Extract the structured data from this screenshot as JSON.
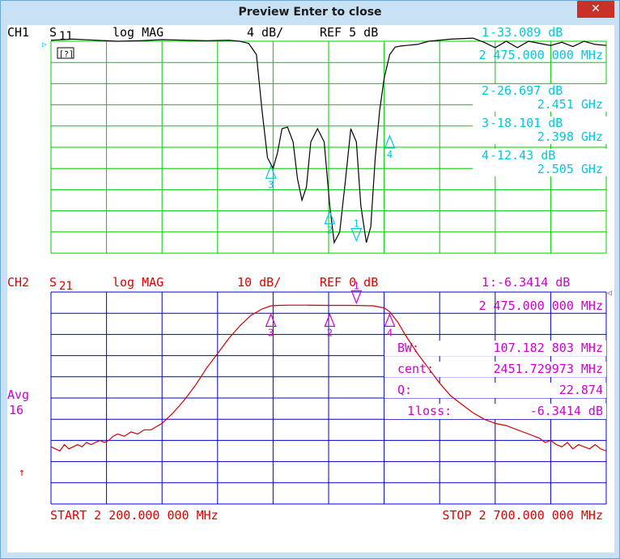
{
  "window": {
    "title": "Preview Enter to close",
    "close_glyph": "✕"
  },
  "colors": {
    "ch1_grid": "#00cc00",
    "ch1_trace": "#000000",
    "ch1_text": "#00c8e0",
    "ch2_grid": "#0000cc",
    "ch2_trace": "#d00000",
    "ch2_text": "#d000d0",
    "red_text": "#e00000"
  },
  "chart_data": [
    {
      "type": "line",
      "channel": "CH1",
      "header": {
        "ch": "CH1",
        "param": "S",
        "param_sub": "11",
        "format": "log MAG",
        "scale": "4 dB/",
        "ref": "REF 5 dB",
        "m1_num": "1",
        "m1_val": " -33.089 dB",
        "m1_freq": "2 475.000 000 MHz",
        "ref_marker": "▷"
      },
      "y_scale": {
        "per_div": 4,
        "ref_level": 5,
        "ref_division": 0,
        "divisions": 10
      },
      "x_range": [
        2200,
        2700
      ],
      "x_divisions": 10,
      "readouts": [
        {
          "num": "2",
          "value": " -26.697 dB",
          "freq": "2.451 GHz"
        },
        {
          "num": "3",
          "value": " -18.101 dB",
          "freq": "2.398 GHz"
        },
        {
          "num": "4",
          "value": " -12.43 dB",
          "freq": "2.505 GHz"
        }
      ],
      "markers": [
        {
          "label": "3",
          "x": 2398,
          "y": -18.1
        },
        {
          "label": "2",
          "x": 2451,
          "y": -26.7
        },
        {
          "label": "1",
          "x": 2475,
          "y": -33.1
        },
        {
          "label": "4",
          "x": 2505,
          "y": -12.4
        }
      ],
      "annotation_box": "⌈?⌉",
      "series": [
        {
          "x": [
            2200,
            2220,
            2240,
            2260,
            2280,
            2300,
            2320,
            2340,
            2360,
            2370,
            2378,
            2385,
            2390,
            2395,
            2400,
            2404,
            2408,
            2413,
            2418,
            2422,
            2426,
            2430,
            2434,
            2440,
            2446,
            2451,
            2455,
            2460,
            2465,
            2470,
            2475,
            2479,
            2484,
            2488,
            2492,
            2496,
            2500,
            2505,
            2510,
            2515,
            2520,
            2530,
            2540,
            2560,
            2580,
            2590,
            2600,
            2610,
            2620,
            2630,
            2640,
            2650,
            2660,
            2670,
            2680,
            2690,
            2700
          ],
          "y": [
            5.2,
            5.4,
            5.2,
            5.0,
            5.1,
            5.3,
            5.2,
            5.1,
            5.2,
            5.0,
            4.6,
            2.5,
            -8,
            -17,
            -19,
            -16,
            -11.5,
            -11.2,
            -14,
            -21,
            -25,
            -22.5,
            -14,
            -11.5,
            -14,
            -26,
            -33,
            -31,
            -21.5,
            -11.5,
            -14,
            -26,
            -33,
            -30,
            -17,
            -8,
            -2,
            2.5,
            3.9,
            4.1,
            4.2,
            4.4,
            5.0,
            5.4,
            5.6,
            4.8,
            3.8,
            5.0,
            3.8,
            5.0,
            4.6,
            4.2,
            4.8,
            4.0,
            5.0,
            4.4,
            4.2
          ]
        }
      ]
    },
    {
      "type": "line",
      "channel": "CH2",
      "header": {
        "ch": "CH2",
        "param": "S",
        "param_sub": "21",
        "format": "log MAG",
        "scale": "10 dB/",
        "ref": "REF 0 dB",
        "m1_num": "1",
        "m1_val": ":-6.3414 dB",
        "m1_freq": "2 475.000 000 MHz",
        "ref_marker": "◁"
      },
      "y_scale": {
        "per_div": 10,
        "ref_level": 0,
        "ref_division": 0,
        "divisions": 10
      },
      "x_range": [
        2200,
        2700
      ],
      "x_divisions": 10,
      "side_label": {
        "avg": "Avg",
        "count": "16",
        "arrow": "↑"
      },
      "readouts": [
        {
          "label": "BW:",
          "value": "107.182 803 MHz"
        },
        {
          "label": "cent:",
          "value": "2451.729973 MHz"
        },
        {
          "label": "Q:",
          "value": "22.874"
        },
        {
          "num": "1",
          "label": " loss:",
          "value": "-6.3414 dB"
        }
      ],
      "markers": [
        {
          "label": "3",
          "x": 2398,
          "y": -9.3
        },
        {
          "label": "2",
          "x": 2451,
          "y": -9.3
        },
        {
          "label": "1",
          "x": 2475,
          "y": -6.3
        },
        {
          "label": "4",
          "x": 2505,
          "y": -9.3
        }
      ],
      "series": [
        {
          "x": [
            2200,
            2204,
            2208,
            2212,
            2216,
            2220,
            2224,
            2228,
            2232,
            2236,
            2240,
            2244,
            2248,
            2252,
            2256,
            2260,
            2266,
            2272,
            2278,
            2284,
            2290,
            2300,
            2310,
            2320,
            2330,
            2340,
            2350,
            2360,
            2370,
            2380,
            2390,
            2398,
            2405,
            2415,
            2430,
            2450,
            2470,
            2490,
            2500,
            2505,
            2512,
            2520,
            2530,
            2540,
            2550,
            2560,
            2570,
            2580,
            2590,
            2600,
            2610,
            2620,
            2630,
            2640,
            2645,
            2650,
            2655,
            2660,
            2665,
            2670,
            2675,
            2680,
            2685,
            2690,
            2695,
            2700
          ],
          "y": [
            -73,
            -74,
            -75,
            -72,
            -74,
            -73,
            -72,
            -73,
            -71,
            -72,
            -71,
            -70,
            -71,
            -70,
            -68,
            -67,
            -68,
            -66,
            -67,
            -65,
            -65,
            -62,
            -57,
            -51,
            -44,
            -36,
            -29,
            -22,
            -16,
            -11,
            -8,
            -6.5,
            -6.3,
            -6.2,
            -6.2,
            -6.3,
            -6.3,
            -6.5,
            -7.5,
            -9.3,
            -14,
            -21,
            -29,
            -36,
            -43,
            -49,
            -53,
            -57,
            -60,
            -62,
            -63,
            -65,
            -67,
            -69,
            -71,
            -70,
            -72,
            -73,
            -71,
            -74,
            -72,
            -73,
            -74,
            -72,
            -74,
            -75
          ]
        }
      ]
    }
  ],
  "footer": {
    "start": "START 2 200.000 000 MHz",
    "stop": "STOP 2 700.000 000 MHz"
  }
}
